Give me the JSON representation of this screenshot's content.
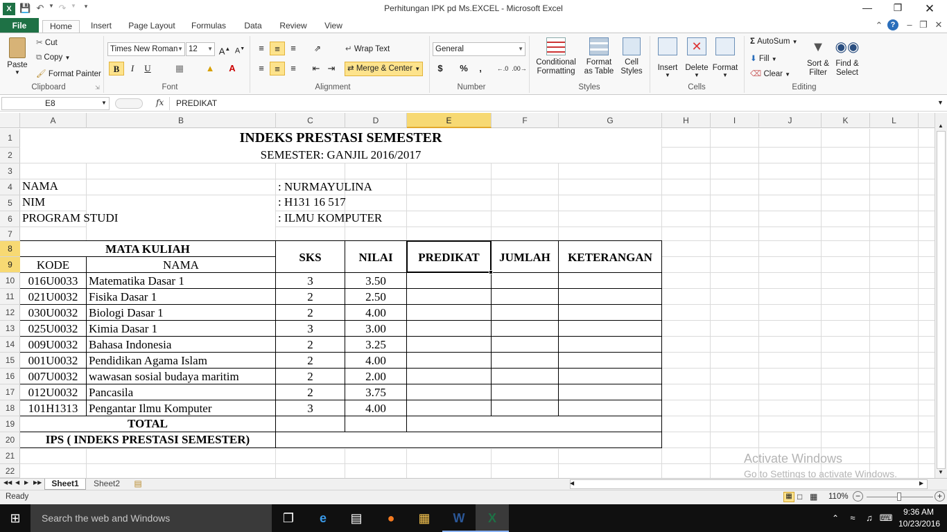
{
  "window": {
    "title": "Perhitungan IPK pd Ms.EXCEL  -  Microsoft Excel"
  },
  "tabs": [
    "File",
    "Home",
    "Insert",
    "Page Layout",
    "Formulas",
    "Data",
    "Review",
    "View"
  ],
  "ribbon": {
    "clipboard": {
      "paste": "Paste",
      "cut": "Cut",
      "copy": "Copy",
      "format_painter": "Format Painter",
      "label": "Clipboard"
    },
    "font": {
      "name": "Times New Roman",
      "size": "12",
      "label": "Font",
      "bold": "B",
      "italic": "I",
      "underline": "U"
    },
    "alignment": {
      "wrap": "Wrap Text",
      "merge": "Merge & Center",
      "label": "Alignment"
    },
    "number": {
      "format": "General",
      "label": "Number",
      "currency": "$",
      "percent": "%",
      "comma": ","
    },
    "styles": {
      "cond_line1": "Conditional",
      "cond_line2": "Formatting",
      "fmt_line1": "Format",
      "fmt_line2": "as Table",
      "cell_line1": "Cell",
      "cell_line2": "Styles",
      "label": "Styles"
    },
    "cells": {
      "insert": "Insert",
      "delete": "Delete",
      "format": "Format",
      "label": "Cells"
    },
    "editing": {
      "autosum": "AutoSum",
      "fill": "Fill",
      "clear": "Clear",
      "sort_line1": "Sort &",
      "sort_line2": "Filter",
      "find_line1": "Find &",
      "find_line2": "Select",
      "label": "Editing"
    }
  },
  "formula_bar": {
    "name_box": "E8",
    "fx": "fx",
    "content": "PREDIKAT"
  },
  "columns": [
    "A",
    "B",
    "C",
    "D",
    "E",
    "F",
    "G",
    "H",
    "I",
    "J",
    "K",
    "L"
  ],
  "rows": [
    "1",
    "2",
    "3",
    "4",
    "5",
    "6",
    "7",
    "8",
    "9",
    "10",
    "11",
    "12",
    "13",
    "14",
    "15",
    "16",
    "17",
    "18",
    "19",
    "20",
    "21",
    "22"
  ],
  "sheet": {
    "title": "INDEKS PRESTASI SEMESTER",
    "subtitle": "SEMESTER: GANJIL 2016/2017",
    "nama_label": "NAMA",
    "nama_value": ": NURMAYULINA",
    "nim_label": "NIM",
    "nim_value": ": H131 16 517",
    "prodi_label": "PROGRAM STUDI",
    "prodi_value": ": ILMU KOMPUTER",
    "hdr_matkul": "MATA KULIAH",
    "hdr_kode": "KODE",
    "hdr_nama": "NAMA",
    "hdr_sks": "SKS",
    "hdr_nilai": "NILAI",
    "hdr_predikat": "PREDIKAT",
    "hdr_jumlah": "JUMLAH",
    "hdr_keterangan": "KETERANGAN",
    "courses": [
      {
        "kode": "016U0033",
        "nama": "Matematika Dasar 1",
        "sks": "3",
        "nilai": "3.50"
      },
      {
        "kode": "021U0032",
        "nama": "Fisika Dasar 1",
        "sks": "2",
        "nilai": "2.50"
      },
      {
        "kode": "030U0032",
        "nama": "Biologi Dasar 1",
        "sks": "2",
        "nilai": "4.00"
      },
      {
        "kode": "025U0032",
        "nama": "Kimia Dasar 1",
        "sks": "3",
        "nilai": "3.00"
      },
      {
        "kode": "009U0032",
        "nama": "Bahasa Indonesia",
        "sks": "2",
        "nilai": "3.25"
      },
      {
        "kode": "001U0032",
        "nama": "Pendidikan Agama Islam",
        "sks": "2",
        "nilai": "4.00"
      },
      {
        "kode": "007U0032",
        "nama": "wawasan sosial budaya maritim",
        "sks": "2",
        "nilai": "2.00"
      },
      {
        "kode": "012U0032",
        "nama": "Pancasila",
        "sks": "2",
        "nilai": "3.75"
      },
      {
        "kode": "101H1313",
        "nama": "Pengantar Ilmu Komputer",
        "sks": "3",
        "nilai": "4.00"
      }
    ],
    "total": "TOTAL",
    "ips": "IPS ( INDEKS PRESTASI SEMESTER)"
  },
  "sheet_tabs": [
    "Sheet1",
    "Sheet2"
  ],
  "status": {
    "ready": "Ready",
    "zoom": "110%"
  },
  "watermark": {
    "line1": "Activate Windows",
    "line2": "Go to Settings to activate Windows."
  },
  "taskbar": {
    "search": "Search the web and Windows",
    "time": "9:36 AM",
    "date": "10/23/2016"
  },
  "colors": {
    "excel_green": "#1e7145",
    "selection": "#f7d973"
  }
}
